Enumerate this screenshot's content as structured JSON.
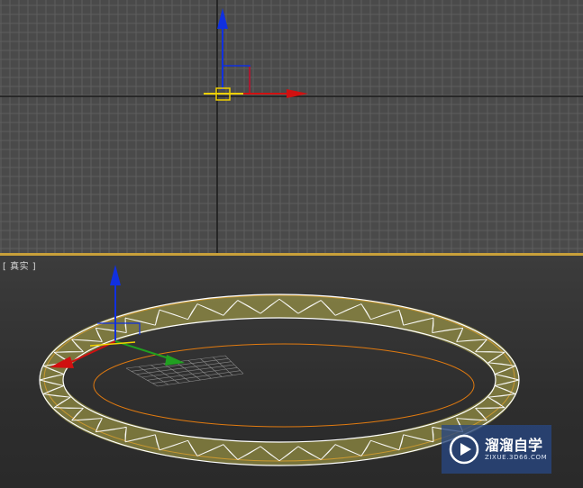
{
  "viewport_top": {
    "name": "top-orthographic-viewport",
    "grid": "on"
  },
  "viewport_perspective": {
    "label": "[ 真实 ]",
    "shading": "realistic"
  },
  "colors": {
    "grid_line": "#5e5e5e",
    "axis_line": "#1a1a1a",
    "x_axis": "#d01010",
    "y_axis": "#1030e0",
    "z_axis": "#20a020",
    "gizmo": "#f0d000",
    "selection": "#e07a10",
    "mesh_fill": "#b8b04a",
    "mesh_wire": "#ffffff",
    "split_bar": "#c8a03a"
  },
  "watermark": {
    "title": "溜溜自学",
    "subtitle": "ZIXUE.3D66.COM"
  }
}
